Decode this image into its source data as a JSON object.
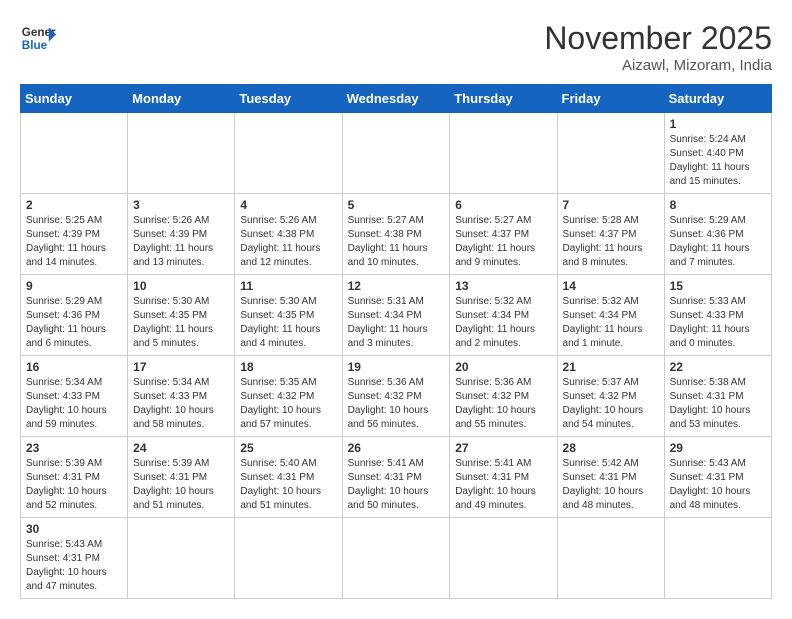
{
  "header": {
    "logo_general": "General",
    "logo_blue": "Blue",
    "title": "November 2025",
    "location": "Aizawl, Mizoram, India"
  },
  "days_of_week": [
    "Sunday",
    "Monday",
    "Tuesday",
    "Wednesday",
    "Thursday",
    "Friday",
    "Saturday"
  ],
  "weeks": [
    [
      {
        "day": "",
        "info": ""
      },
      {
        "day": "",
        "info": ""
      },
      {
        "day": "",
        "info": ""
      },
      {
        "day": "",
        "info": ""
      },
      {
        "day": "",
        "info": ""
      },
      {
        "day": "",
        "info": ""
      },
      {
        "day": "1",
        "info": "Sunrise: 5:24 AM\nSunset: 4:40 PM\nDaylight: 11 hours and 15 minutes."
      }
    ],
    [
      {
        "day": "2",
        "info": "Sunrise: 5:25 AM\nSunset: 4:39 PM\nDaylight: 11 hours and 14 minutes."
      },
      {
        "day": "3",
        "info": "Sunrise: 5:26 AM\nSunset: 4:39 PM\nDaylight: 11 hours and 13 minutes."
      },
      {
        "day": "4",
        "info": "Sunrise: 5:26 AM\nSunset: 4:38 PM\nDaylight: 11 hours and 12 minutes."
      },
      {
        "day": "5",
        "info": "Sunrise: 5:27 AM\nSunset: 4:38 PM\nDaylight: 11 hours and 10 minutes."
      },
      {
        "day": "6",
        "info": "Sunrise: 5:27 AM\nSunset: 4:37 PM\nDaylight: 11 hours and 9 minutes."
      },
      {
        "day": "7",
        "info": "Sunrise: 5:28 AM\nSunset: 4:37 PM\nDaylight: 11 hours and 8 minutes."
      },
      {
        "day": "8",
        "info": "Sunrise: 5:29 AM\nSunset: 4:36 PM\nDaylight: 11 hours and 7 minutes."
      }
    ],
    [
      {
        "day": "9",
        "info": "Sunrise: 5:29 AM\nSunset: 4:36 PM\nDaylight: 11 hours and 6 minutes."
      },
      {
        "day": "10",
        "info": "Sunrise: 5:30 AM\nSunset: 4:35 PM\nDaylight: 11 hours and 5 minutes."
      },
      {
        "day": "11",
        "info": "Sunrise: 5:30 AM\nSunset: 4:35 PM\nDaylight: 11 hours and 4 minutes."
      },
      {
        "day": "12",
        "info": "Sunrise: 5:31 AM\nSunset: 4:34 PM\nDaylight: 11 hours and 3 minutes."
      },
      {
        "day": "13",
        "info": "Sunrise: 5:32 AM\nSunset: 4:34 PM\nDaylight: 11 hours and 2 minutes."
      },
      {
        "day": "14",
        "info": "Sunrise: 5:32 AM\nSunset: 4:34 PM\nDaylight: 11 hours and 1 minute."
      },
      {
        "day": "15",
        "info": "Sunrise: 5:33 AM\nSunset: 4:33 PM\nDaylight: 11 hours and 0 minutes."
      }
    ],
    [
      {
        "day": "16",
        "info": "Sunrise: 5:34 AM\nSunset: 4:33 PM\nDaylight: 10 hours and 59 minutes."
      },
      {
        "day": "17",
        "info": "Sunrise: 5:34 AM\nSunset: 4:33 PM\nDaylight: 10 hours and 58 minutes."
      },
      {
        "day": "18",
        "info": "Sunrise: 5:35 AM\nSunset: 4:32 PM\nDaylight: 10 hours and 57 minutes."
      },
      {
        "day": "19",
        "info": "Sunrise: 5:36 AM\nSunset: 4:32 PM\nDaylight: 10 hours and 56 minutes."
      },
      {
        "day": "20",
        "info": "Sunrise: 5:36 AM\nSunset: 4:32 PM\nDaylight: 10 hours and 55 minutes."
      },
      {
        "day": "21",
        "info": "Sunrise: 5:37 AM\nSunset: 4:32 PM\nDaylight: 10 hours and 54 minutes."
      },
      {
        "day": "22",
        "info": "Sunrise: 5:38 AM\nSunset: 4:31 PM\nDaylight: 10 hours and 53 minutes."
      }
    ],
    [
      {
        "day": "23",
        "info": "Sunrise: 5:39 AM\nSunset: 4:31 PM\nDaylight: 10 hours and 52 minutes."
      },
      {
        "day": "24",
        "info": "Sunrise: 5:39 AM\nSunset: 4:31 PM\nDaylight: 10 hours and 51 minutes."
      },
      {
        "day": "25",
        "info": "Sunrise: 5:40 AM\nSunset: 4:31 PM\nDaylight: 10 hours and 51 minutes."
      },
      {
        "day": "26",
        "info": "Sunrise: 5:41 AM\nSunset: 4:31 PM\nDaylight: 10 hours and 50 minutes."
      },
      {
        "day": "27",
        "info": "Sunrise: 5:41 AM\nSunset: 4:31 PM\nDaylight: 10 hours and 49 minutes."
      },
      {
        "day": "28",
        "info": "Sunrise: 5:42 AM\nSunset: 4:31 PM\nDaylight: 10 hours and 48 minutes."
      },
      {
        "day": "29",
        "info": "Sunrise: 5:43 AM\nSunset: 4:31 PM\nDaylight: 10 hours and 48 minutes."
      }
    ],
    [
      {
        "day": "30",
        "info": "Sunrise: 5:43 AM\nSunset: 4:31 PM\nDaylight: 10 hours and 47 minutes."
      },
      {
        "day": "",
        "info": ""
      },
      {
        "day": "",
        "info": ""
      },
      {
        "day": "",
        "info": ""
      },
      {
        "day": "",
        "info": ""
      },
      {
        "day": "",
        "info": ""
      },
      {
        "day": "",
        "info": ""
      }
    ]
  ]
}
